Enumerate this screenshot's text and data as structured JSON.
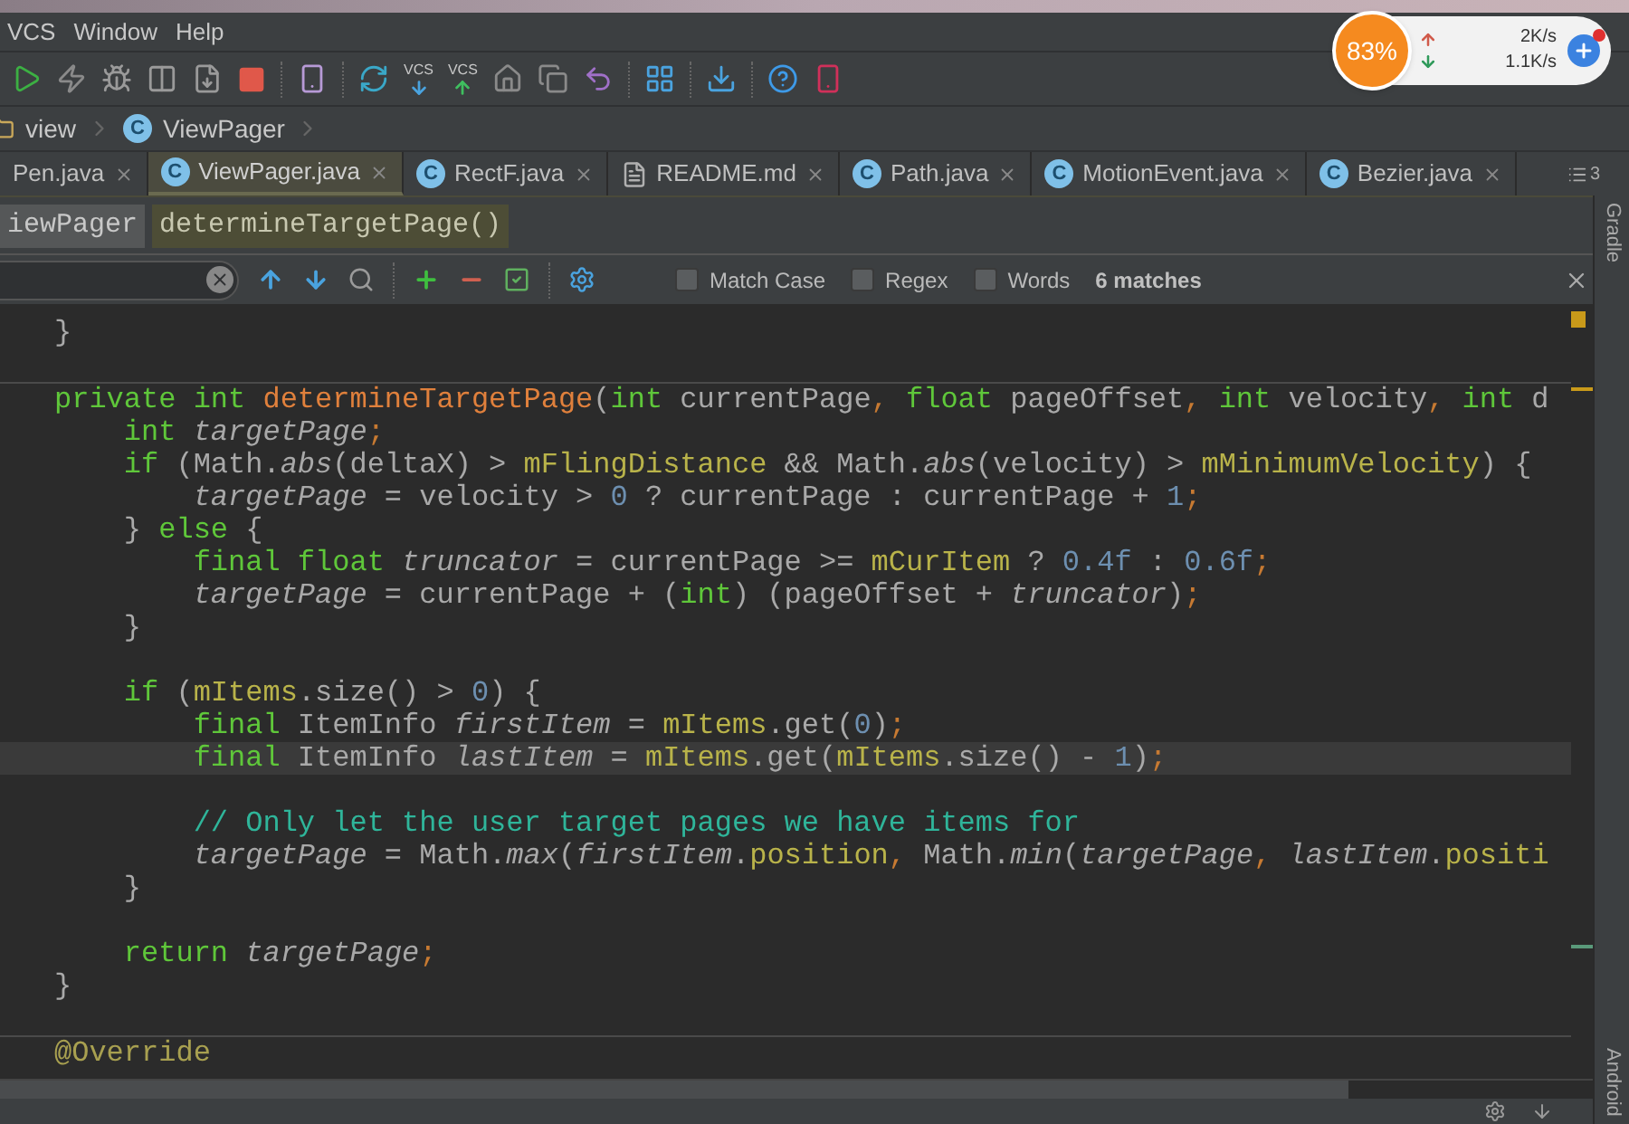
{
  "menu": [
    {
      "label": "VCS"
    },
    {
      "label": "Window"
    },
    {
      "label": "Help"
    }
  ],
  "toolbar": {
    "vcs_labels": [
      "VCS",
      "VCS"
    ]
  },
  "breadcrumb": [
    {
      "kind": "folder",
      "label": "view"
    },
    {
      "kind": "class",
      "badge": "C",
      "label": "ViewPager"
    }
  ],
  "tabs": [
    {
      "kind": "class",
      "label": "Pen.java",
      "selected": false
    },
    {
      "kind": "class",
      "badge": "C",
      "label": "ViewPager.java",
      "selected": true
    },
    {
      "kind": "class",
      "badge": "C",
      "label": "RectF.java",
      "selected": false
    },
    {
      "kind": "file",
      "label": "README.md",
      "selected": false
    },
    {
      "kind": "class",
      "badge": "C",
      "label": "Path.java",
      "selected": false
    },
    {
      "kind": "class",
      "badge": "C",
      "label": "MotionEvent.java",
      "selected": false
    },
    {
      "kind": "class",
      "badge": "C",
      "label": "Bezier.java",
      "selected": false
    }
  ],
  "tab_overflow": {
    "count": "3"
  },
  "structure_path": [
    {
      "label": "iewPager",
      "selected": false
    },
    {
      "label": "determineTargetPage()",
      "selected": true
    }
  ],
  "find_bar": {
    "options": [
      {
        "label": "Match Case",
        "checked": false
      },
      {
        "label": "Regex",
        "checked": false
      },
      {
        "label": "Words",
        "checked": false
      }
    ],
    "match_count": "6 matches"
  },
  "code": {
    "blocks": [
      {
        "lines": [
          {
            "kind": "code",
            "current": false,
            "tokens": [
              {
                "kind": "plain",
                "text": "}"
              }
            ]
          },
          {
            "kind": "blank"
          }
        ]
      },
      {
        "lines": [
          {
            "kind": "code",
            "current": false,
            "tokens": [
              {
                "kind": "kw",
                "text": "private int "
              },
              {
                "kind": "decl",
                "text": "determineTargetPage"
              },
              {
                "kind": "plain",
                "text": "("
              },
              {
                "kind": "kw",
                "text": "int "
              },
              {
                "kind": "plain",
                "text": "currentPage"
              },
              {
                "kind": "punct",
                "text": ", "
              },
              {
                "kind": "kw",
                "text": "float "
              },
              {
                "kind": "plain",
                "text": "pageOffset"
              },
              {
                "kind": "punct",
                "text": ", "
              },
              {
                "kind": "kw",
                "text": "int "
              },
              {
                "kind": "plain",
                "text": "velocity"
              },
              {
                "kind": "punct",
                "text": ", "
              },
              {
                "kind": "kw",
                "text": "int "
              },
              {
                "kind": "plain",
                "text": "d"
              }
            ]
          },
          {
            "kind": "code",
            "current": false,
            "tokens": [
              {
                "kind": "kw",
                "text": "    int "
              },
              {
                "kind": "local",
                "text": "targetPage"
              },
              {
                "kind": "punct",
                "text": ";"
              }
            ]
          },
          {
            "kind": "code",
            "current": false,
            "tokens": [
              {
                "kind": "kw",
                "text": "    if "
              },
              {
                "kind": "plain",
                "text": "(Math."
              },
              {
                "kind": "static",
                "text": "abs"
              },
              {
                "kind": "plain",
                "text": "(deltaX) > "
              },
              {
                "kind": "field",
                "text": "mFlingDistance"
              },
              {
                "kind": "plain",
                "text": " && Math."
              },
              {
                "kind": "static",
                "text": "abs"
              },
              {
                "kind": "plain",
                "text": "(velocity) > "
              },
              {
                "kind": "field",
                "text": "mMinimumVelocity"
              },
              {
                "kind": "plain",
                "text": ") {"
              }
            ]
          },
          {
            "kind": "code",
            "current": false,
            "tokens": [
              {
                "kind": "local",
                "text": "        targetPage"
              },
              {
                "kind": "plain",
                "text": " = velocity > "
              },
              {
                "kind": "num",
                "text": "0"
              },
              {
                "kind": "plain",
                "text": " ? currentPage : currentPage + "
              },
              {
                "kind": "num",
                "text": "1"
              },
              {
                "kind": "punct",
                "text": ";"
              }
            ]
          },
          {
            "kind": "code",
            "current": false,
            "tokens": [
              {
                "kind": "plain",
                "text": "    } "
              },
              {
                "kind": "kw",
                "text": "else "
              },
              {
                "kind": "plain",
                "text": "{"
              }
            ]
          },
          {
            "kind": "code",
            "current": false,
            "tokens": [
              {
                "kind": "kw",
                "text": "        final float "
              },
              {
                "kind": "local",
                "text": "truncator"
              },
              {
                "kind": "plain",
                "text": " = currentPage >= "
              },
              {
                "kind": "field",
                "text": "mCurItem"
              },
              {
                "kind": "plain",
                "text": " ? "
              },
              {
                "kind": "num",
                "text": "0.4f"
              },
              {
                "kind": "plain",
                "text": " : "
              },
              {
                "kind": "num",
                "text": "0.6f"
              },
              {
                "kind": "punct",
                "text": ";"
              }
            ]
          },
          {
            "kind": "code",
            "current": false,
            "tokens": [
              {
                "kind": "local",
                "text": "        targetPage"
              },
              {
                "kind": "plain",
                "text": " = currentPage + ("
              },
              {
                "kind": "kw",
                "text": "int"
              },
              {
                "kind": "plain",
                "text": ") (pageOffset + "
              },
              {
                "kind": "local",
                "text": "truncator"
              },
              {
                "kind": "plain",
                "text": ")"
              },
              {
                "kind": "punct",
                "text": ";"
              }
            ]
          },
          {
            "kind": "code",
            "current": false,
            "tokens": [
              {
                "kind": "plain",
                "text": "    }"
              }
            ]
          },
          {
            "kind": "blank"
          },
          {
            "kind": "code",
            "current": false,
            "tokens": [
              {
                "kind": "kw",
                "text": "    if "
              },
              {
                "kind": "plain",
                "text": "("
              },
              {
                "kind": "field",
                "text": "mItems"
              },
              {
                "kind": "plain",
                "text": ".size() > "
              },
              {
                "kind": "num",
                "text": "0"
              },
              {
                "kind": "plain",
                "text": ") {"
              }
            ]
          },
          {
            "kind": "code",
            "current": false,
            "tokens": [
              {
                "kind": "kw",
                "text": "        final "
              },
              {
                "kind": "plain",
                "text": "ItemInfo "
              },
              {
                "kind": "local",
                "text": "firstItem"
              },
              {
                "kind": "plain",
                "text": " = "
              },
              {
                "kind": "field",
                "text": "mItems"
              },
              {
                "kind": "plain",
                "text": ".get("
              },
              {
                "kind": "num",
                "text": "0"
              },
              {
                "kind": "plain",
                "text": ")"
              },
              {
                "kind": "punct",
                "text": ";"
              }
            ]
          },
          {
            "kind": "code",
            "current": true,
            "tokens": [
              {
                "kind": "kw",
                "text": "        final "
              },
              {
                "kind": "plain",
                "text": "ItemInfo "
              },
              {
                "kind": "local",
                "text": "lastItem"
              },
              {
                "kind": "plain",
                "text": " = "
              },
              {
                "kind": "field",
                "text": "mItems"
              },
              {
                "kind": "plain",
                "text": ".get("
              },
              {
                "kind": "field",
                "text": "mItems"
              },
              {
                "kind": "plain",
                "text": ".size() - "
              },
              {
                "kind": "num",
                "text": "1"
              },
              {
                "kind": "plain",
                "text": ")"
              },
              {
                "kind": "punct",
                "text": ";"
              }
            ]
          },
          {
            "kind": "blank"
          },
          {
            "kind": "code",
            "current": false,
            "tokens": [
              {
                "kind": "comment",
                "text": "        // Only let the user target pages we have items for"
              }
            ]
          },
          {
            "kind": "code",
            "current": false,
            "tokens": [
              {
                "kind": "local",
                "text": "        targetPage"
              },
              {
                "kind": "plain",
                "text": " = Math."
              },
              {
                "kind": "static",
                "text": "max"
              },
              {
                "kind": "plain",
                "text": "("
              },
              {
                "kind": "local",
                "text": "firstItem"
              },
              {
                "kind": "plain",
                "text": "."
              },
              {
                "kind": "field",
                "text": "position"
              },
              {
                "kind": "punct",
                "text": ", "
              },
              {
                "kind": "plain",
                "text": "Math."
              },
              {
                "kind": "static",
                "text": "min"
              },
              {
                "kind": "plain",
                "text": "("
              },
              {
                "kind": "local",
                "text": "targetPage"
              },
              {
                "kind": "punct",
                "text": ", "
              },
              {
                "kind": "local",
                "text": "lastItem"
              },
              {
                "kind": "plain",
                "text": "."
              },
              {
                "kind": "field",
                "text": "positi"
              }
            ]
          },
          {
            "kind": "code",
            "current": false,
            "tokens": [
              {
                "kind": "plain",
                "text": "    }"
              }
            ]
          },
          {
            "kind": "blank"
          },
          {
            "kind": "code",
            "current": false,
            "tokens": [
              {
                "kind": "kw",
                "text": "    return "
              },
              {
                "kind": "local",
                "text": "targetPage"
              },
              {
                "kind": "punct",
                "text": ";"
              }
            ]
          },
          {
            "kind": "code",
            "current": false,
            "tokens": [
              {
                "kind": "plain",
                "text": "}"
              }
            ]
          },
          {
            "kind": "blank"
          }
        ]
      },
      {
        "lines": [
          {
            "kind": "code",
            "current": false,
            "tokens": [
              {
                "kind": "annotation",
                "text": "@Override"
              }
            ]
          }
        ]
      }
    ]
  },
  "side_tools": [
    {
      "label": "Gradle"
    },
    {
      "label": "Android"
    }
  ],
  "network_widget": {
    "cpu_load": "83%",
    "upload": "2K/s",
    "download": "1.1K/s"
  }
}
